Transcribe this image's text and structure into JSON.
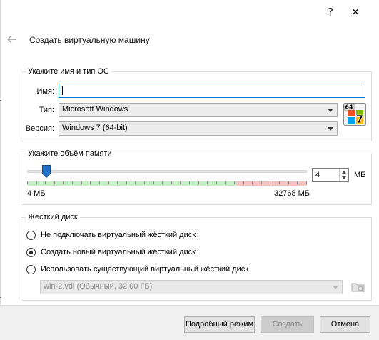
{
  "window": {
    "help_glyph": "?",
    "close_glyph": "✕"
  },
  "page_title": "Создать виртуальную машину",
  "name_type_group": {
    "legend": "Укажите имя и тип ОС",
    "name_label": "Имя:",
    "name_value": "",
    "type_label": "Тип:",
    "type_value": "Microsoft Windows",
    "version_label": "Версия:",
    "version_value": "Windows 7 (64-bit)",
    "os_icon": "windows-7-64-icon",
    "os_icon_badge": "64",
    "os_icon_digit": "7"
  },
  "memory_group": {
    "legend": "Укажите объём памяти",
    "value": "4",
    "unit": "МБ",
    "min_label": "4 МБ",
    "max_label": "32768 МБ",
    "slider_fraction": 0.07,
    "green_fraction": 0.75,
    "colors": {
      "green": "#c6efc6",
      "red": "#f5c2c2",
      "handle": "#1f6fc5"
    }
  },
  "disk_group": {
    "legend": "Жесткий диск",
    "options": [
      {
        "label": "Не подключать виртуальный жёсткий диск",
        "checked": false
      },
      {
        "label": "Создать новый виртуальный жёсткий диск",
        "checked": true
      },
      {
        "label": "Использовать существующий виртуальный жёсткий диск",
        "checked": false
      }
    ],
    "existing_disk_value": "win-2.vdi (Обычный, 32,00 ГБ)"
  },
  "buttons": {
    "expert": "Подробный режим",
    "create": "Создать",
    "cancel": "Отмена"
  }
}
